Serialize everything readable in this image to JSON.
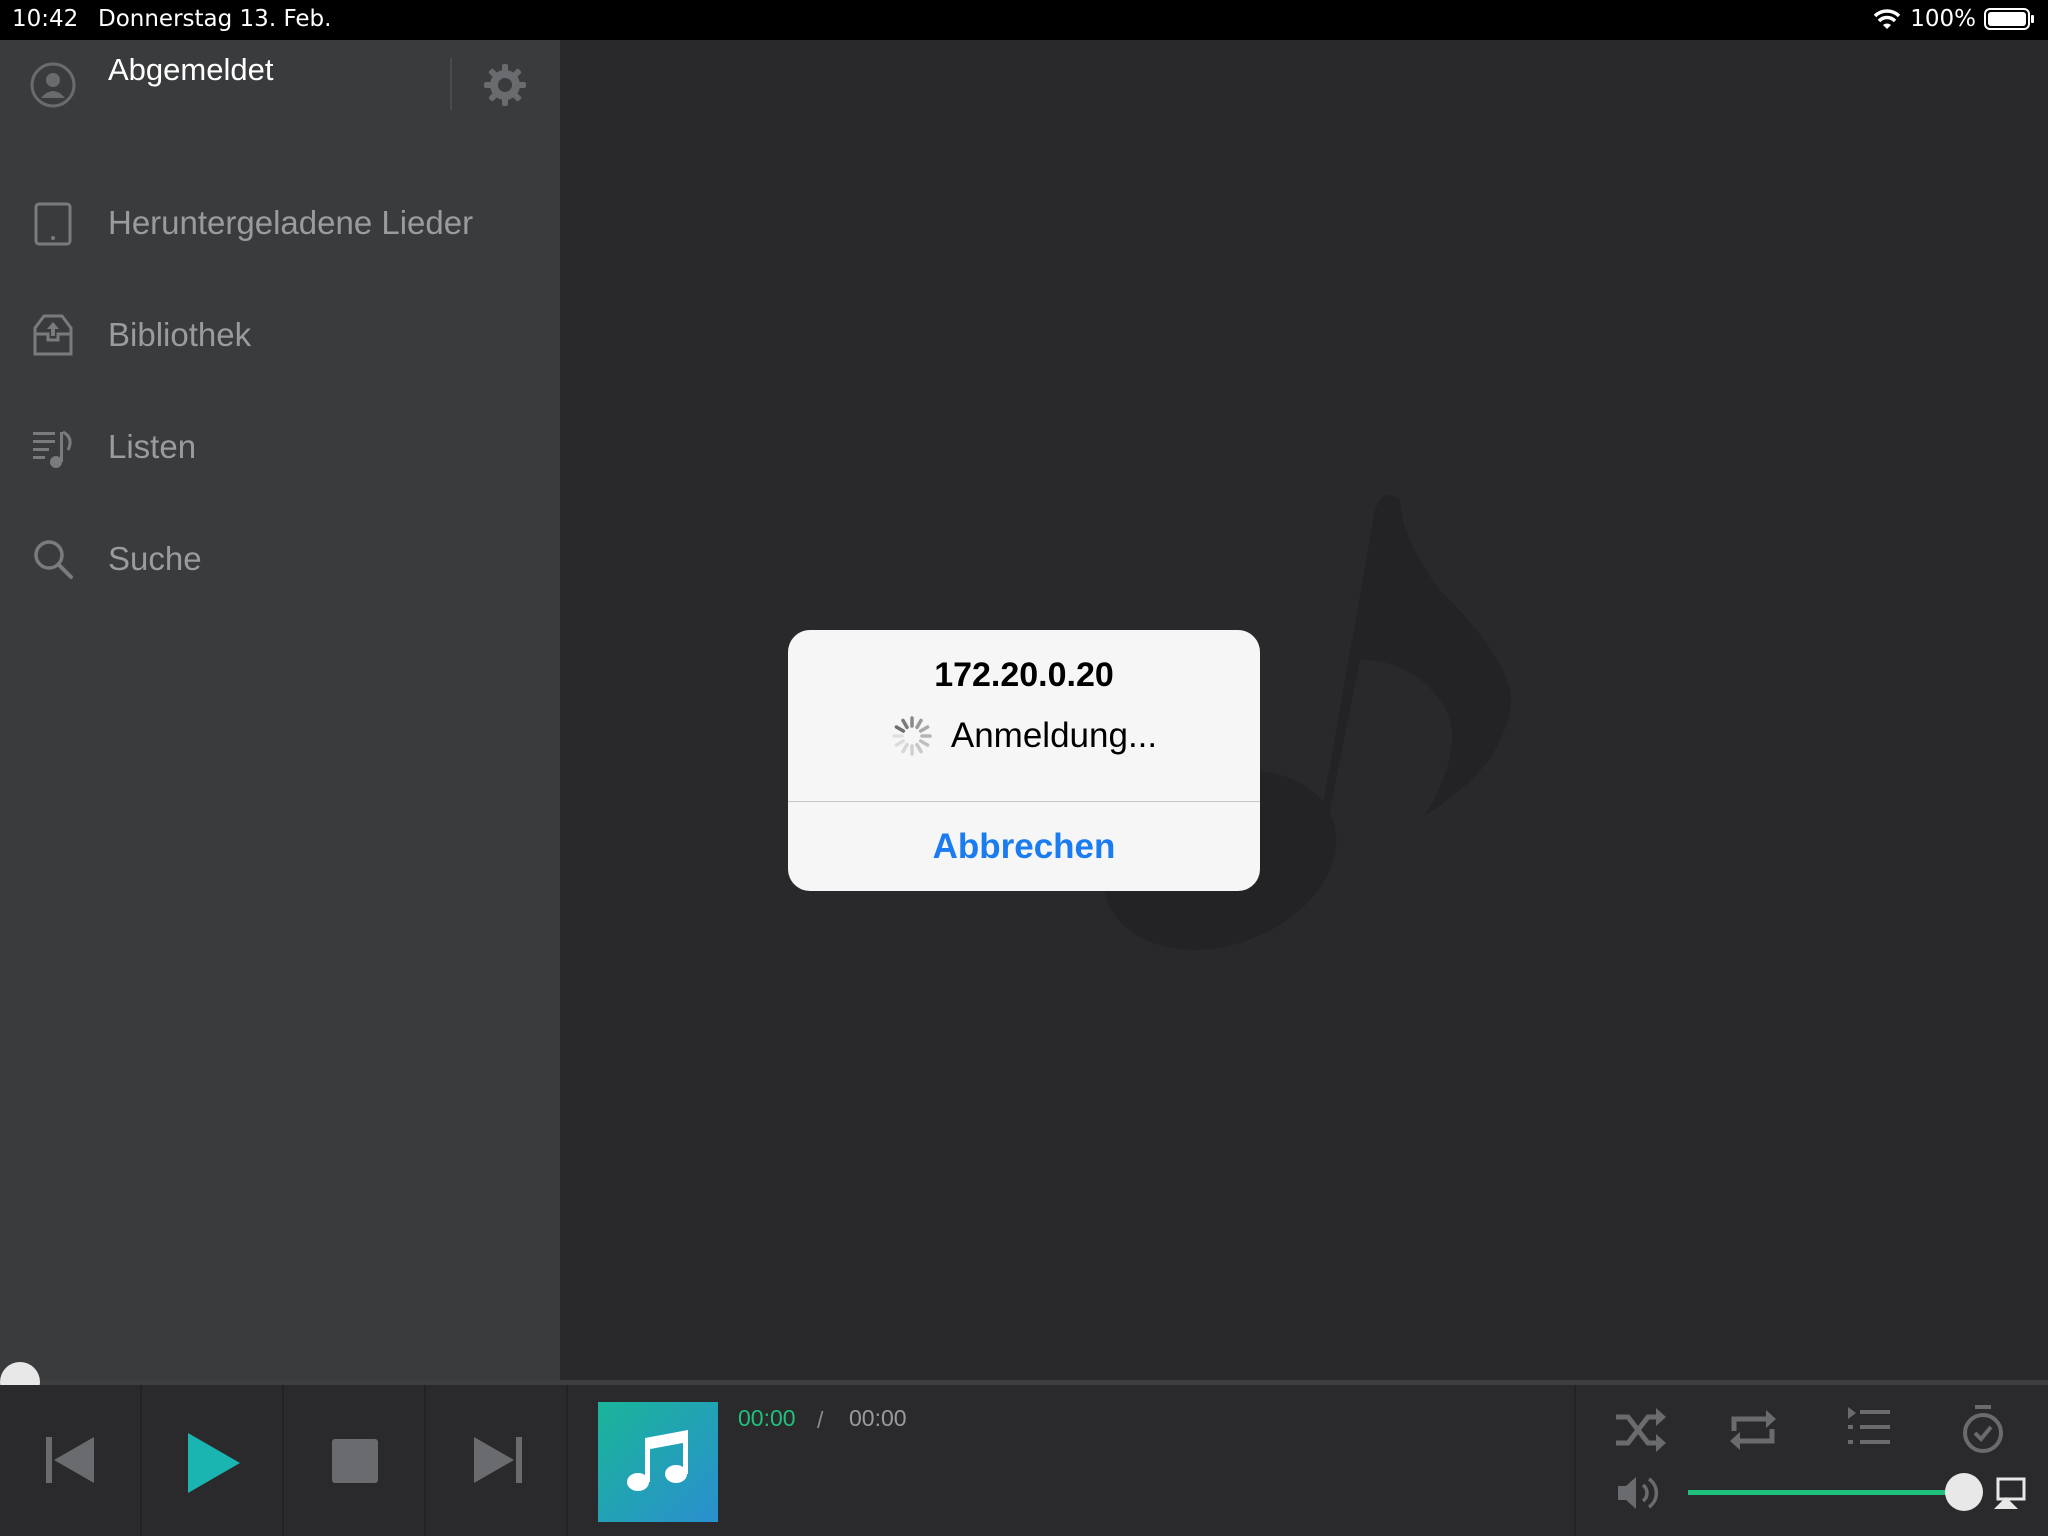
{
  "status_bar": {
    "time": "10:42",
    "date": "Donnerstag 13. Feb.",
    "battery": "100%"
  },
  "sidebar": {
    "account_label": "Abgemeldet",
    "items": [
      {
        "label": "Heruntergeladene Lieder",
        "icon": "tablet-icon"
      },
      {
        "label": "Bibliothek",
        "icon": "library-icon"
      },
      {
        "label": "Listen",
        "icon": "playlist-icon"
      },
      {
        "label": "Suche",
        "icon": "search-icon"
      }
    ]
  },
  "dialog": {
    "title": "172.20.0.20",
    "message": "Anmeldung...",
    "cancel_label": "Abbrechen"
  },
  "player": {
    "current_time": "00:00",
    "separator": "/",
    "total_time": "00:00",
    "progress": 0,
    "volume": 0.95
  },
  "colors": {
    "accent_green": "#1fc07c",
    "play_teal": "#1ab5b0",
    "link_blue": "#1a7cf0"
  }
}
